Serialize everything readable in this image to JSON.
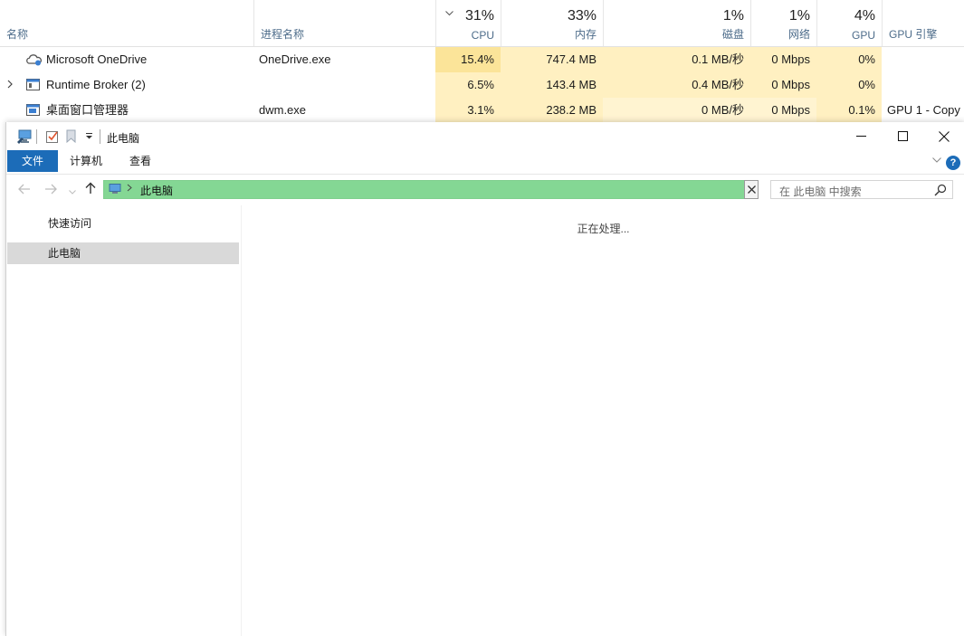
{
  "task_manager": {
    "columns": {
      "name": {
        "label": "名称"
      },
      "process": {
        "label": "进程名称"
      },
      "cpu": {
        "pct": "31%",
        "label": "CPU"
      },
      "memory": {
        "pct": "33%",
        "label": "内存"
      },
      "disk": {
        "pct": "1%",
        "label": "磁盘"
      },
      "network": {
        "pct": "1%",
        "label": "网络"
      },
      "gpu": {
        "pct": "4%",
        "label": "GPU"
      },
      "gpu_engine": {
        "label": "GPU 引擎"
      }
    },
    "rows": [
      {
        "name": "Microsoft OneDrive",
        "process": "OneDrive.exe",
        "cpu": "15.4%",
        "memory": "747.4 MB",
        "disk": "0.1 MB/秒",
        "network": "0 Mbps",
        "gpu": "0%",
        "gpu_engine": "",
        "icon": "onedrive-icon"
      },
      {
        "name": "Runtime Broker (2)",
        "process": "",
        "cpu": "6.5%",
        "memory": "143.4 MB",
        "disk": "0.4 MB/秒",
        "network": "0 Mbps",
        "gpu": "0%",
        "gpu_engine": "",
        "icon": "app-window-icon"
      },
      {
        "name": "桌面窗口管理器",
        "process": "dwm.exe",
        "cpu": "3.1%",
        "memory": "238.2 MB",
        "disk": "0 MB/秒",
        "network": "0 Mbps",
        "gpu": "0.1%",
        "gpu_engine": "GPU 1 - Copy",
        "icon": "app-window-icon"
      }
    ]
  },
  "explorer": {
    "title": "此电脑",
    "ribbon_tabs": {
      "file": "文件",
      "computer": "计算机",
      "view": "查看"
    },
    "address": {
      "location": "此电脑"
    },
    "search": {
      "placeholder": "在 此电脑 中搜索"
    },
    "nav": {
      "quick_access": "快速访问",
      "this_pc": "此电脑"
    },
    "status_text": "正在处理...",
    "help": "?",
    "colors": {
      "file_tab": "#1c6cb8",
      "address_bar": "#84d794",
      "nav_selected": "#d9d9d9"
    }
  }
}
